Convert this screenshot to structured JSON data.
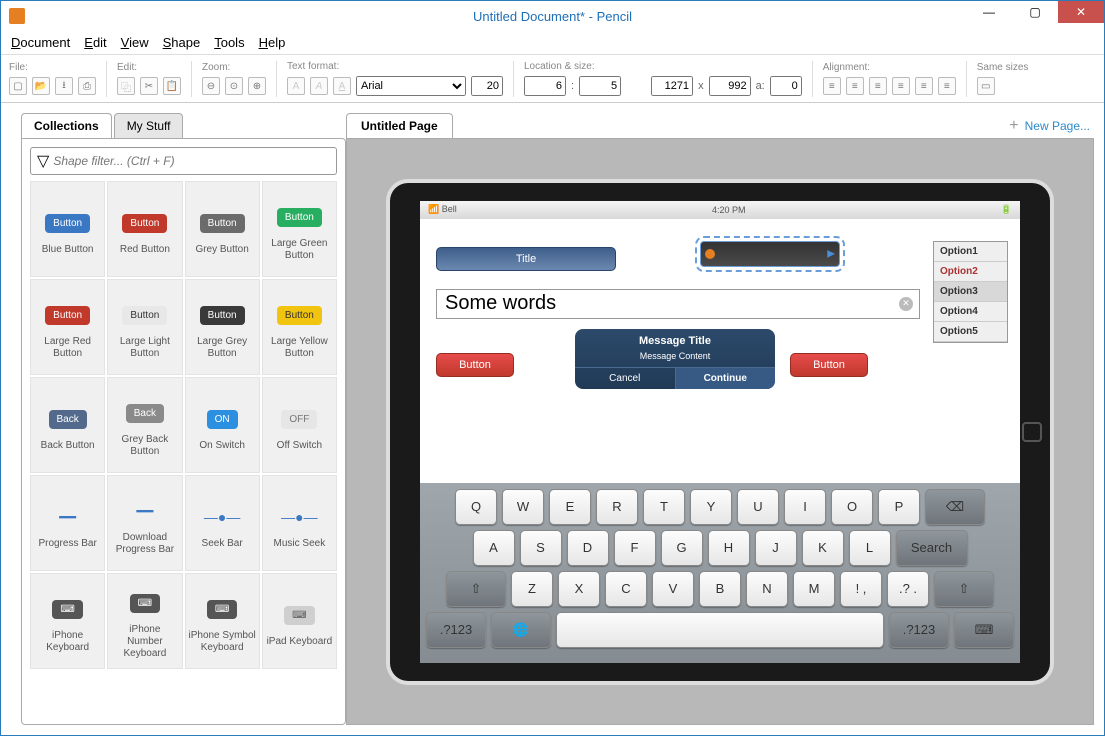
{
  "window": {
    "title": "Untitled Document* - Pencil",
    "minimize": "—",
    "maximize": "▢",
    "close": "✕"
  },
  "menubar": [
    "Document",
    "Edit",
    "View",
    "Shape",
    "Tools",
    "Help"
  ],
  "toolbar": {
    "file_label": "File:",
    "edit_label": "Edit:",
    "zoom_label": "Zoom:",
    "text_format_label": "Text format:",
    "font_name": "Arial",
    "font_size": "20",
    "location_size_label": "Location & size:",
    "x": "6",
    "y": "5",
    "w": "1271",
    "h": "992",
    "a": "0",
    "mult": "x",
    "a_label": "a:",
    "colon": ":",
    "alignment_label": "Alignment:",
    "same_sizes_label": "Same sizes"
  },
  "sidebar": {
    "tabs": [
      "Collections",
      "My Stuff"
    ],
    "filter_placeholder": "Shape filter... (Ctrl + F)",
    "shapes": [
      {
        "label": "Blue Button",
        "text": "Button",
        "bg": "#3b78c4"
      },
      {
        "label": "Red Button",
        "text": "Button",
        "bg": "#c0392b"
      },
      {
        "label": "Grey Button",
        "text": "Button",
        "bg": "#6b6b6b"
      },
      {
        "label": "Large Green Button",
        "text": "Button",
        "bg": "#27ae60"
      },
      {
        "label": "Large Red Button",
        "text": "Button",
        "bg": "#c0392b"
      },
      {
        "label": "Large Light Button",
        "text": "Button",
        "bg": "#e8e8e8",
        "fg": "#333"
      },
      {
        "label": "Large Grey Button",
        "text": "Button",
        "bg": "#3a3a3a"
      },
      {
        "label": "Large Yellow Button",
        "text": "Button",
        "bg": "#f1c40f",
        "fg": "#333"
      },
      {
        "label": "Back Button",
        "text": "Back",
        "bg": "#546a8c"
      },
      {
        "label": "Grey Back Button",
        "text": "Back",
        "bg": "#8a8a8a"
      },
      {
        "label": "On Switch",
        "text": "ON",
        "bg": "#2d8fe0"
      },
      {
        "label": "Off Switch",
        "text": "OFF",
        "bg": "#e6e6e6",
        "fg": "#777"
      },
      {
        "label": "Progress Bar",
        "text": "━━",
        "bg": "transparent",
        "fg": "#3b78c4"
      },
      {
        "label": "Download Progress Bar",
        "text": "━━",
        "bg": "transparent",
        "fg": "#3b78c4"
      },
      {
        "label": "Seek Bar",
        "text": "—●—",
        "bg": "transparent",
        "fg": "#3b78c4"
      },
      {
        "label": "Music Seek",
        "text": "—●—",
        "bg": "transparent",
        "fg": "#3b78c4"
      },
      {
        "label": "iPhone Keyboard",
        "text": "⌨",
        "bg": "#555"
      },
      {
        "label": "iPhone Number Keyboard",
        "text": "⌨",
        "bg": "#555"
      },
      {
        "label": "iPhone Symbol Keyboard",
        "text": "⌨",
        "bg": "#555"
      },
      {
        "label": "iPad Keyboard",
        "text": "⌨",
        "bg": "#cfcfcf",
        "fg": "#555"
      }
    ]
  },
  "canvas": {
    "page_tab": "Untitled Page",
    "new_page": "New Page...",
    "plus": "+",
    "ipad": {
      "carrier": "Bell",
      "time": "4:20 PM",
      "title_widget": "Title",
      "textbox_value": "Some words",
      "options": [
        "Option1",
        "Option2",
        "Option3",
        "Option4",
        "Option5"
      ],
      "button_label": "Button",
      "dialog": {
        "title": "Message Title",
        "content": "Message Content",
        "cancel": "Cancel",
        "continue": "Continue"
      },
      "keyboard": {
        "row1": [
          "Q",
          "W",
          "E",
          "R",
          "T",
          "Y",
          "U",
          "I",
          "O",
          "P",
          "⌫"
        ],
        "row2": [
          "A",
          "S",
          "D",
          "F",
          "G",
          "H",
          "J",
          "K",
          "L",
          "Search"
        ],
        "row3": [
          "⇧",
          "Z",
          "X",
          "C",
          "V",
          "B",
          "N",
          "M",
          "!\n,",
          ".?\n.",
          "⇧"
        ],
        "row4": [
          ".?123",
          "🌐",
          "",
          ".?123",
          "⌨"
        ]
      }
    }
  }
}
